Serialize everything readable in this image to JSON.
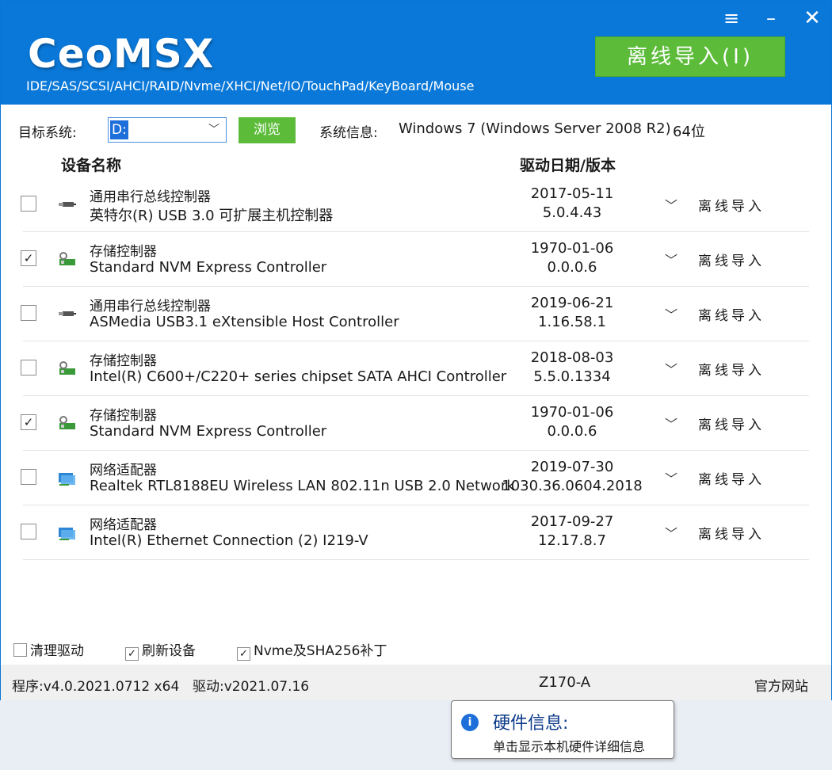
{
  "header": {
    "logo": "CeoMSX",
    "subtitle": "IDE/SAS/SCSI/AHCI/RAID/Nvme/XHCI/Net/IO/TouchPad/KeyBoard/Mouse",
    "offline_import_button": "离线导入(I)",
    "menu_icon": "hamburger-icon",
    "minimize_icon": "minimize-icon",
    "close_icon": "close-icon"
  },
  "toolbar": {
    "target_label": "目标系统:",
    "target_value": "D:",
    "browse_label": "浏览",
    "sysinfo_label": "系统信息:",
    "os": "Windows 7 (Windows Server 2008 R2)",
    "bits": "64位"
  },
  "columns": {
    "device_name": "设备名称",
    "driver_date_version": "驱动日期/版本"
  },
  "devices": [
    {
      "checked": false,
      "icon": "usb-icon",
      "category": "通用串行总线控制器",
      "name": "英特尔(R) USB 3.0 可扩展主机控制器",
      "date": "2017-05-11",
      "version": "5.0.4.43",
      "action": "离线导入"
    },
    {
      "checked": true,
      "icon": "storage-icon",
      "category": "存储控制器",
      "name": "Standard NVM Express Controller",
      "date": "1970-01-06",
      "version": "0.0.0.6",
      "action": "离线导入"
    },
    {
      "checked": false,
      "icon": "usb-icon",
      "category": "通用串行总线控制器",
      "name": "ASMedia USB3.1 eXtensible Host Controller",
      "date": "2019-06-21",
      "version": "1.16.58.1",
      "action": "离线导入"
    },
    {
      "checked": false,
      "icon": "storage-icon",
      "category": "存储控制器",
      "name": "Intel(R) C600+/C220+ series chipset SATA AHCI Controller",
      "date": "2018-08-03",
      "version": "5.5.0.1334",
      "action": "离线导入"
    },
    {
      "checked": true,
      "icon": "storage-icon",
      "category": "存储控制器",
      "name": "Standard NVM Express Controller",
      "date": "1970-01-06",
      "version": "0.0.0.6",
      "action": "离线导入"
    },
    {
      "checked": false,
      "icon": "network-icon",
      "category": "网络适配器",
      "name": "Realtek RTL8188EU Wireless LAN 802.11n USB 2.0 Network",
      "date": "2019-07-30",
      "version": "1030.36.0604.2018",
      "action": "离线导入"
    },
    {
      "checked": false,
      "icon": "network-icon",
      "category": "网络适配器",
      "name": "Intel(R) Ethernet Connection (2) I219-V",
      "date": "2017-09-27",
      "version": "12.17.8.7",
      "action": "离线导入"
    }
  ],
  "options": {
    "clean_driver": {
      "label": "清理驱动",
      "checked": false
    },
    "refresh_devices": {
      "label": "刷新设备",
      "checked": true
    },
    "nvme_patch": {
      "label": "Nvme及SHA256补丁",
      "checked": true
    }
  },
  "footer": {
    "program": "程序:v4.0.2021.0712 x64",
    "driver": "驱动:v2021.07.16",
    "board": "Z170-A",
    "website": "官方网站"
  },
  "tooltip": {
    "icon": "info-icon",
    "title": "硬件信息:",
    "text": "单击显示本机硬件详细信息"
  },
  "colors": {
    "header_blue": "#0a78d8",
    "button_green": "#5cbc3a"
  }
}
